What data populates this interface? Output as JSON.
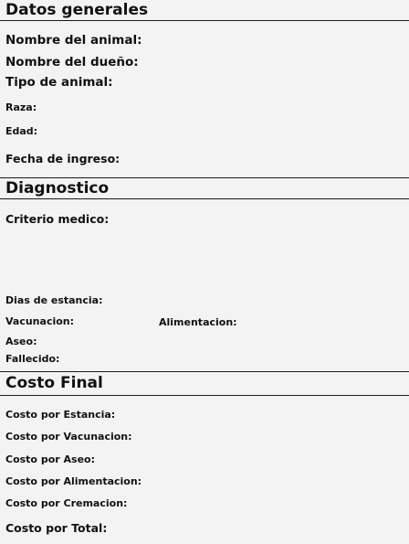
{
  "datos_generales": {
    "title": "Datos generales",
    "nombre_animal": "Nombre del animal:",
    "nombre_dueno": "Nombre del dueño:",
    "tipo_animal": "Tipo de animal:",
    "raza": "Raza:",
    "edad": "Edad:",
    "fecha_ingreso": "Fecha de ingreso:"
  },
  "diagnostico": {
    "title": "Diagnostico",
    "criterio_medico": "Criterio medico:",
    "dias_estancia": "Dias de estancia:",
    "vacunacion": "Vacunacion:",
    "alimentacion": "Alimentacion:",
    "aseo": "Aseo:",
    "fallecido": "Fallecido:"
  },
  "costo_final": {
    "title": "Costo Final",
    "estancia": "Costo por Estancia:",
    "vacunacion": "Costo por Vacunacion:",
    "aseo": "Costo por Aseo:",
    "alimentacion": "Costo por Alimentacion:",
    "cremacion": "Costo por Cremacion:",
    "total": "Costo por Total:"
  }
}
